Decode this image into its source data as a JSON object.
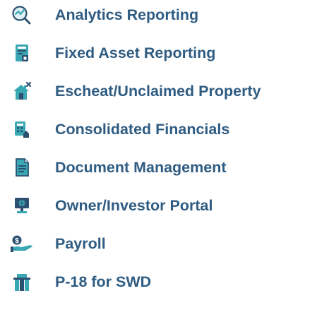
{
  "colors": {
    "label": "#2f5c82",
    "icon_teal": "#3aa8b3",
    "icon_dark": "#2c5070"
  },
  "menu": {
    "items": [
      {
        "label": "Analytics Reporting",
        "icon": "analytics-icon"
      },
      {
        "label": "Fixed Asset Reporting",
        "icon": "fixed-asset-icon"
      },
      {
        "label": "Escheat/Unclaimed Property",
        "icon": "escheat-property-icon"
      },
      {
        "label": "Consolidated Financials",
        "icon": "consolidated-financials-icon"
      },
      {
        "label": "Document Management",
        "icon": "document-icon"
      },
      {
        "label": "Owner/Investor Portal",
        "icon": "portal-icon"
      },
      {
        "label": "Payroll",
        "icon": "payroll-icon"
      },
      {
        "label": "P-18 for SWD",
        "icon": "p18-icon"
      }
    ]
  }
}
